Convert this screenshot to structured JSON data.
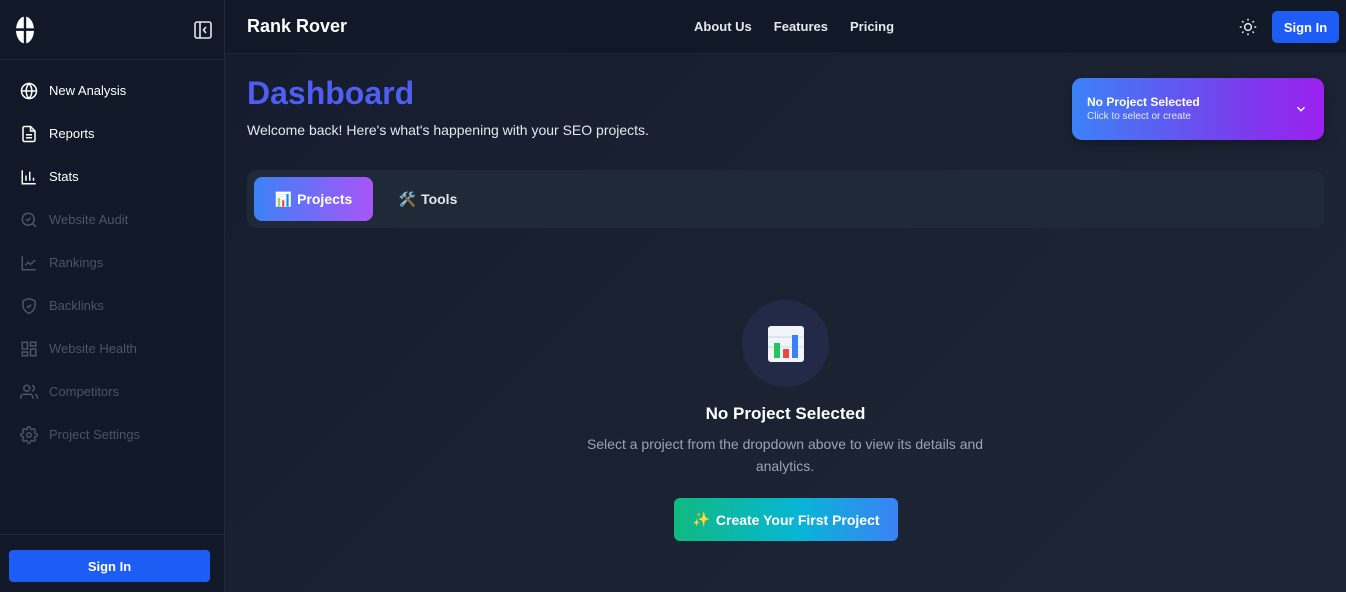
{
  "sidebar": {
    "items": [
      {
        "label": "New Analysis",
        "icon": "globe-icon",
        "enabled": true
      },
      {
        "label": "Reports",
        "icon": "document-icon",
        "enabled": true
      },
      {
        "label": "Stats",
        "icon": "bar-chart-icon",
        "enabled": true
      },
      {
        "label": "Website Audit",
        "icon": "search-check-icon",
        "enabled": false
      },
      {
        "label": "Rankings",
        "icon": "trend-line-icon",
        "enabled": false
      },
      {
        "label": "Backlinks",
        "icon": "shield-icon",
        "enabled": false
      },
      {
        "label": "Website Health",
        "icon": "grid-icon",
        "enabled": false
      },
      {
        "label": "Competitors",
        "icon": "users-icon",
        "enabled": false
      },
      {
        "label": "Project Settings",
        "icon": "gear-icon",
        "enabled": false
      }
    ],
    "sign_in_label": "Sign In"
  },
  "header": {
    "brand": "Rank Rover",
    "nav": [
      "About Us",
      "Features",
      "Pricing"
    ],
    "sign_in_label": "Sign In"
  },
  "main": {
    "title": "Dashboard",
    "subtitle": "Welcome back! Here's what's happening with your SEO projects.",
    "project_select": {
      "title": "No Project Selected",
      "subtitle": "Click to select or create"
    },
    "tabs": [
      {
        "icon": "📊",
        "label": "Projects"
      },
      {
        "icon": "🛠️",
        "label": "Tools"
      }
    ],
    "empty_state": {
      "icon": "📊",
      "title": "No Project Selected",
      "description": "Select a project from the dropdown above to view its details and analytics.",
      "button_icon": "✨",
      "button_label": "Create Your First Project"
    }
  },
  "colors": {
    "accent_blue": "#1d5cf5",
    "title_indigo": "#4f5ef0",
    "background": "#111827"
  }
}
